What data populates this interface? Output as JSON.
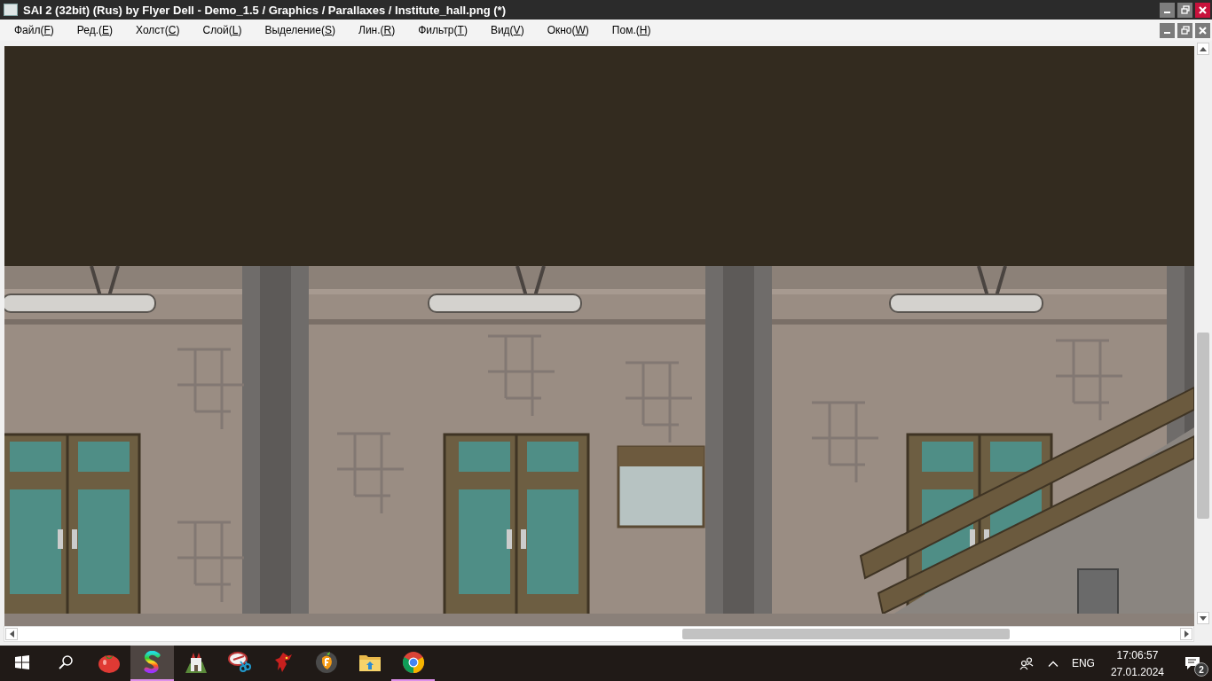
{
  "window": {
    "title": "SAI 2 (32bit) (Rus) by Flyer Dell - Demo_1.5 / Graphics / Parallaxes / Institute_hall.png (*)"
  },
  "menu": [
    {
      "before": "Файл(",
      "key": "F",
      "after": ")"
    },
    {
      "before": "Ред.(",
      "key": "E",
      "after": ")"
    },
    {
      "before": "Холст(",
      "key": "C",
      "after": ")"
    },
    {
      "before": "Слой(",
      "key": "L",
      "after": ")"
    },
    {
      "before": "Выделение(",
      "key": "S",
      "after": ")"
    },
    {
      "before": "Лин.(",
      "key": "R",
      "after": ")"
    },
    {
      "before": "Фильтр(",
      "key": "T",
      "after": ")"
    },
    {
      "before": "Вид(",
      "key": "V",
      "after": ")"
    },
    {
      "before": "Окно(",
      "key": "W",
      "after": ")"
    },
    {
      "before": "Пом.(",
      "key": "H",
      "after": ")"
    }
  ],
  "taskbar": {
    "apps": [
      {
        "selected": false,
        "running": false
      },
      {
        "selected": true,
        "running": true
      },
      {
        "selected": false,
        "running": false
      },
      {
        "selected": false,
        "running": false
      },
      {
        "selected": false,
        "running": false
      },
      {
        "selected": false,
        "running": false
      },
      {
        "selected": false,
        "running": false
      },
      {
        "selected": false,
        "running": true
      }
    ],
    "language": "ENG",
    "time": "17:06:57",
    "date": "27.01.2024",
    "notifications": "2"
  }
}
